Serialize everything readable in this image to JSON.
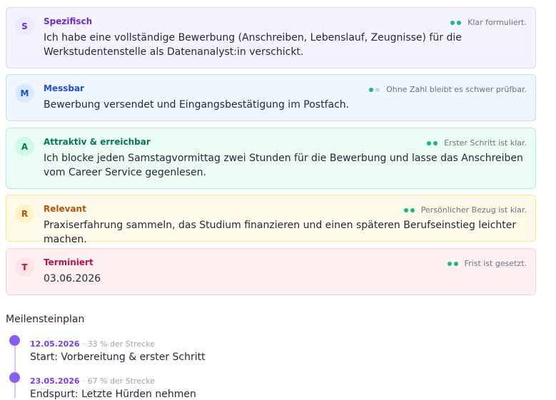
{
  "smart": [
    {
      "letter": "S",
      "title": "Spezifisch",
      "text": "Ich habe eine vollständige Bewerbung (Anschreiben, Lebenslauf, Zeugnisse) für die Werkstudentenstelle als Datenanalyst:in verschickt.",
      "assessment": "Klar formuliert.",
      "score": 2,
      "bg": "#f5f3ff",
      "border": "#ddd6fe",
      "badge_bg": "#ede9fe",
      "accent": "#6d28d9"
    },
    {
      "letter": "M",
      "title": "Messbar",
      "text": "Bewerbung versendet und Eingangsbestätigung im Postfach.",
      "assessment": "Ohne Zahl bleibt es schwer prüfbar.",
      "score": 1,
      "bg": "#eff6ff",
      "border": "#bfdbfe",
      "badge_bg": "#dbeafe",
      "accent": "#1d4ed8"
    },
    {
      "letter": "A",
      "title": "Attraktiv & erreichbar",
      "text": "Ich blocke jeden Samstagvormittag zwei Stunden für die Bewerbung und lasse das Anschreiben vom Career Service gegenlesen.",
      "assessment": "Erster Schritt ist klar.",
      "score": 2,
      "bg": "#ecfdf5",
      "border": "#a7f3d0",
      "badge_bg": "#d1fae5",
      "accent": "#047857"
    },
    {
      "letter": "R",
      "title": "Relevant",
      "text": "Praxiserfahrung sammeln, das Studium finanzieren und einen späteren Berufseinstieg leichter machen.",
      "assessment": "Persönlicher Bezug ist klar.",
      "score": 2,
      "bg": "#fffbeb",
      "border": "#fde68a",
      "badge_bg": "#fef3c7",
      "accent": "#b45309"
    },
    {
      "letter": "T",
      "title": "Terminiert",
      "text": "03.06.2026",
      "assessment": "Frist ist gesetzt.",
      "score": 2,
      "bg": "#fff1f2",
      "border": "#fecdd3",
      "badge_bg": "#ffe4e6",
      "accent": "#be123c"
    }
  ],
  "milestones_heading": "Meilensteinplan",
  "milestones": [
    {
      "date": "12.05.2026",
      "progress": "· 33 % der Strecke",
      "label": "Start: Vorbereitung & erster Schritt"
    },
    {
      "date": "23.05.2026",
      "progress": "· 67 % der Strecke",
      "label": "Endspurt: Letzte Hürden nehmen"
    }
  ]
}
